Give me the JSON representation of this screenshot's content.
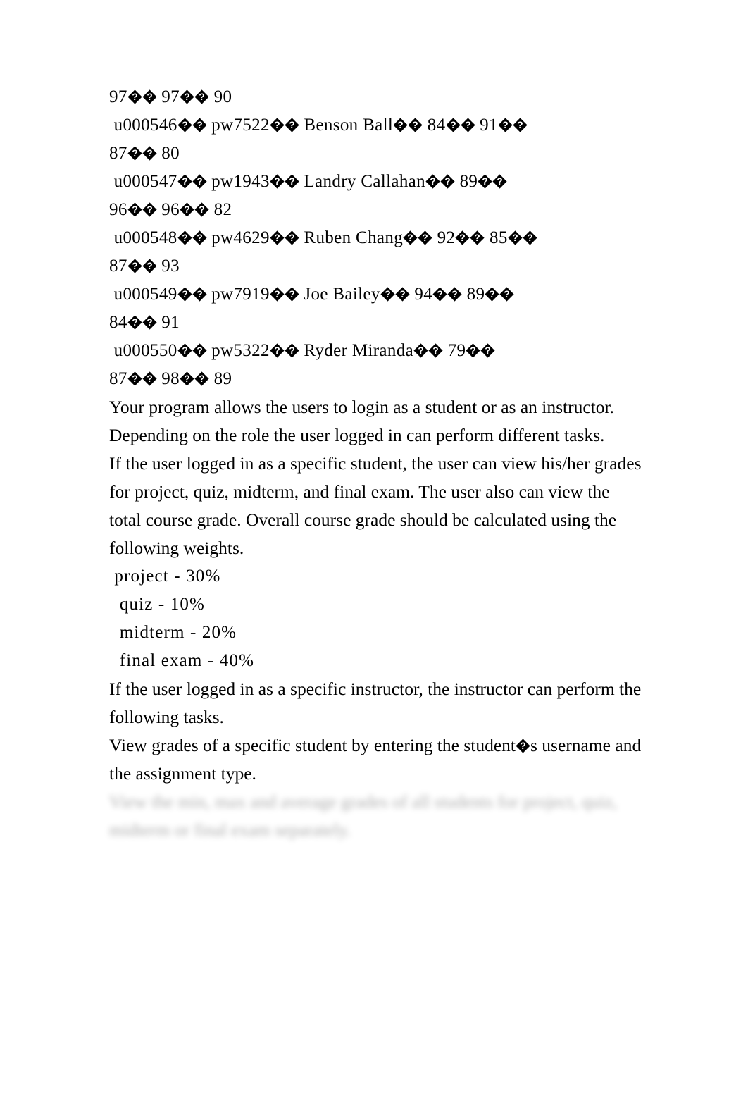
{
  "document": {
    "background_color": "#ffffff",
    "text_color": "#000000",
    "replacement_char_name": "replacement-character",
    "roster_lines": [
      "97�� 97�� 90",
      " u000546�� pw7522�� Benson Ball�� 84�� 91��",
      "87�� 80",
      " u000547�� pw1943�� Landry Callahan�� 89��",
      "96�� 96�� 82",
      " u000548�� pw4629�� Ruben Chang�� 92�� 85��",
      "87�� 93",
      " u000549�� pw7919�� Joe Bailey�� 94�� 89��",
      "84�� 91",
      " u000550�� pw5322�� Ryder Miranda�� 79��",
      "87�� 98�� 89"
    ],
    "paragraph_roles": "Your program allows the users to login as a student or as an instructor. Depending on the role the user logged in can perform different tasks.",
    "paragraph_student": "If the user logged in as a specific student, the user can view his/her grades for project, quiz, midterm, and final exam. The user also can view the total course grade. Overall course grade should be calculated using the following weights.",
    "weights": [
      " project - 30%",
      "  quiz - 10%",
      "  midterm - 20%",
      "  final exam - 40%"
    ],
    "paragraph_instructor": "If the user logged in as a specific instructor, the instructor can perform the following tasks.",
    "paragraph_task_view_grades": "View grades of a specific student by entering the student�s username and the assignment type.",
    "paragraph_task_blurred": "View the min, max and average grades of all students for project, quiz, midterm or final exam separately."
  }
}
